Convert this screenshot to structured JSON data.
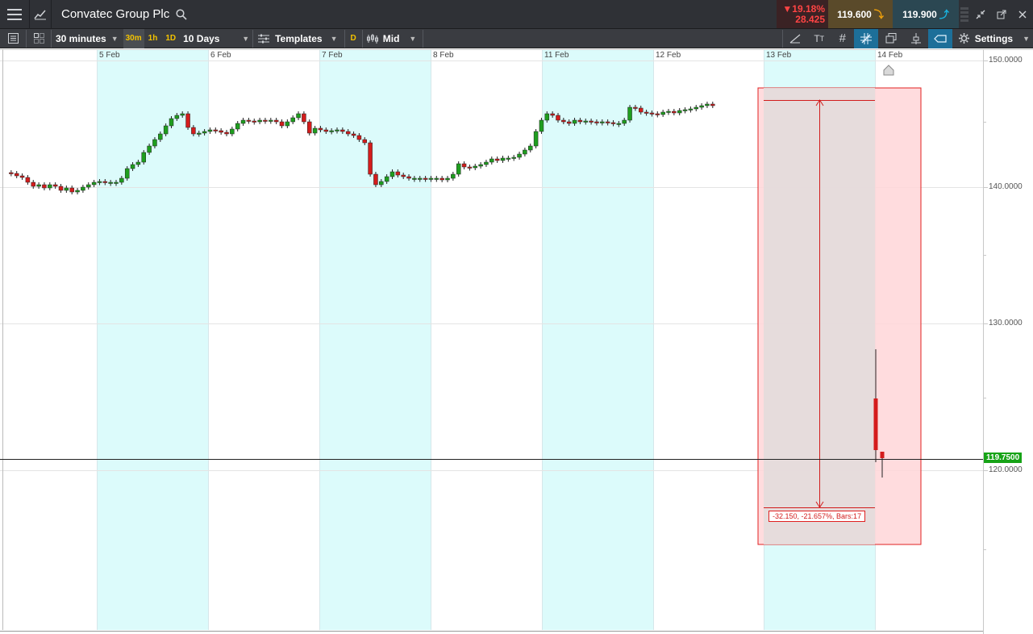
{
  "header": {
    "title": "Convatec Group Plc",
    "change_pct": "19.18%",
    "change_abs": "28.425",
    "sell_price": "119.600",
    "buy_price": "119.900"
  },
  "toolbar": {
    "interval": "30 minutes",
    "quick_30m": "30m",
    "quick_1h": "1h",
    "quick_1d": "1D",
    "range": "10 Days",
    "templates": "Templates",
    "d_badge": "D",
    "price_type": "Mid",
    "settings": "Settings"
  },
  "chart": {
    "dates": [
      "5 Feb",
      "6 Feb",
      "7 Feb",
      "8 Feb",
      "11 Feb",
      "12 Feb",
      "13 Feb",
      "14 Feb"
    ],
    "y_ticks": [
      "150.0000",
      "140.0000",
      "130.0000",
      "120.0000"
    ],
    "last_price": "119.7500",
    "measure_label": "-32.150, -21.657%, Bars:17",
    "colors": {
      "up": "#1e9e1e",
      "down": "#d41c1c",
      "session": "#dcfbfb",
      "grid": "#e4e4e4"
    }
  }
}
